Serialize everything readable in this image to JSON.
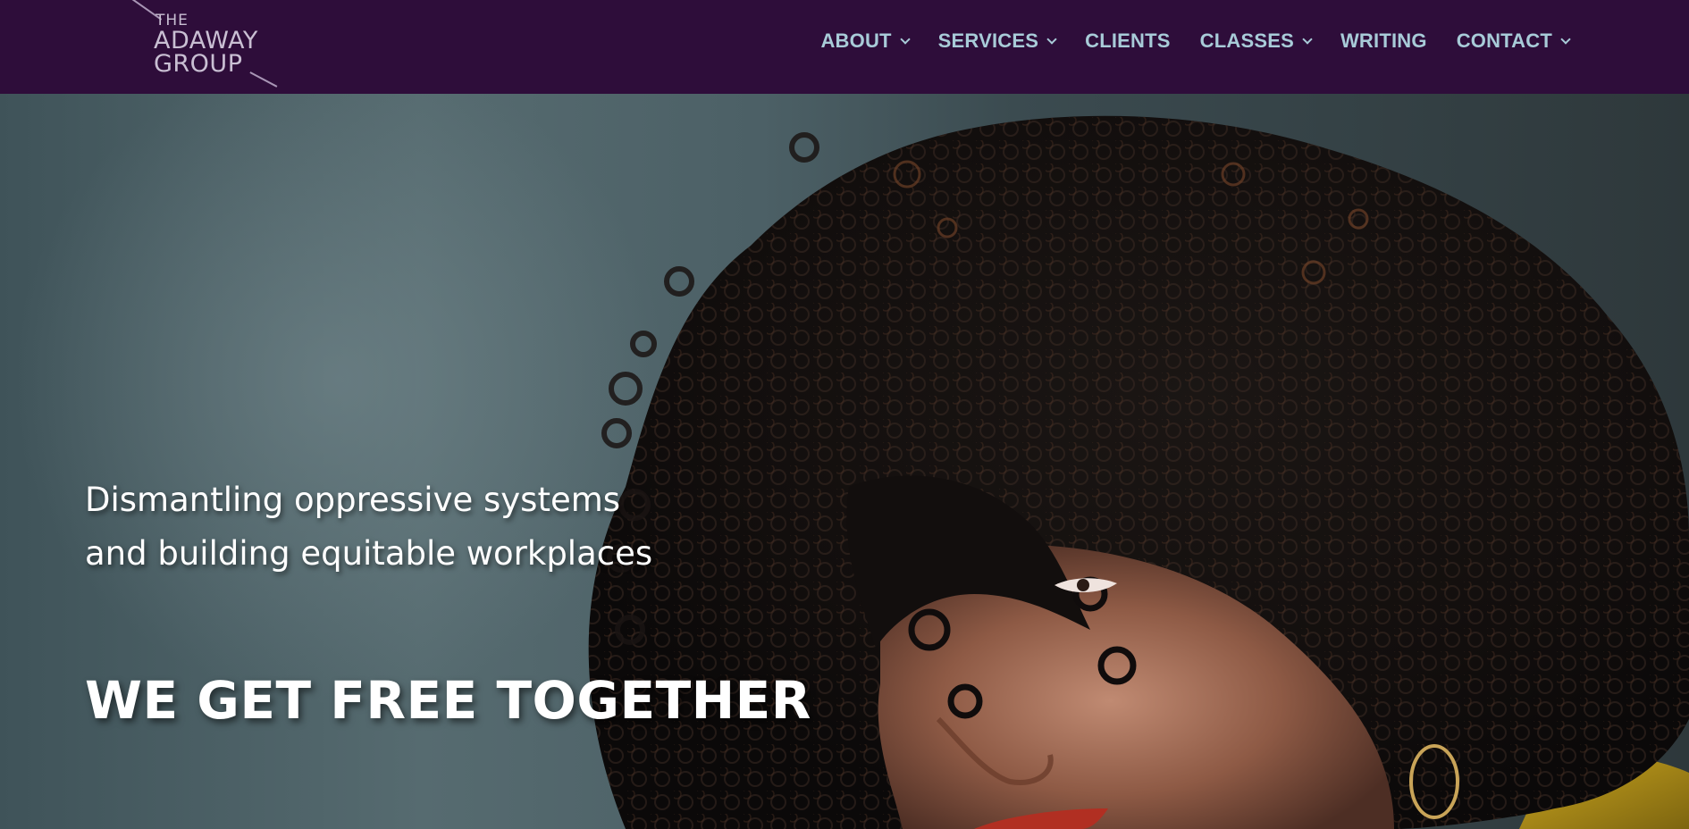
{
  "brand": {
    "line1": "THE",
    "line2": "ADAWAY",
    "line3": "GROUP",
    "color": "#2e0d3a"
  },
  "nav": {
    "items": [
      {
        "label": "ABOUT",
        "dropdown": true
      },
      {
        "label": "SERVICES",
        "dropdown": true
      },
      {
        "label": "CLIENTS",
        "dropdown": false
      },
      {
        "label": "CLASSES",
        "dropdown": true
      },
      {
        "label": "WRITING",
        "dropdown": false
      },
      {
        "label": "CONTACT",
        "dropdown": true
      }
    ],
    "text_color": "#a8cbd8"
  },
  "hero": {
    "tagline_line1": "Dismantling oppressive systems",
    "tagline_line2": "and building equitable workplaces",
    "headline": "WE GET FREE TOGETHER"
  }
}
